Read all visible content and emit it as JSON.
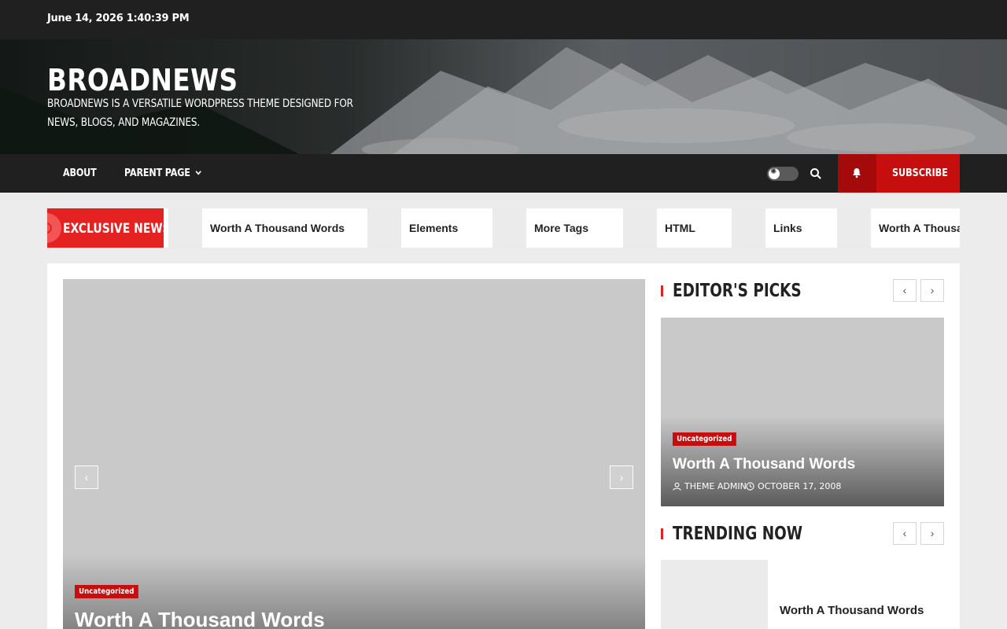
{
  "topbar": {
    "datetime": "June 14, 2026 1:40:39 PM"
  },
  "header": {
    "site_title": "BROADNEWS",
    "site_description": "BROADNEWS IS A VERSATILE WORDPRESS THEME DESIGNED FOR NEWS, BLOGS, AND MAGAZINES."
  },
  "nav": {
    "items": [
      {
        "label": "ABOUT"
      },
      {
        "label": "PARENT PAGE"
      }
    ],
    "subscribe_label": "SUBSCRIBE",
    "icons": [
      "sun-icon",
      "search-icon",
      "bell-icon",
      "chevron-down-icon"
    ]
  },
  "ticker": {
    "label": "EXCLUSIVE NEWS",
    "items": [
      {
        "title": "Worth A Thousand Words"
      },
      {
        "title": "Elements"
      },
      {
        "title": "More Tags"
      },
      {
        "title": "HTML"
      },
      {
        "title": "Links"
      },
      {
        "title": "Worth A Thousand Words"
      }
    ]
  },
  "main_slider": {
    "category": "Uncategorized",
    "title": "Worth A Thousand Words",
    "prev": "‹",
    "next": "›"
  },
  "editors_picks": {
    "heading": "EDITOR'S PICKS",
    "category": "Uncategorized",
    "title": "Worth A Thousand Words",
    "author": "THEME ADMIN",
    "date": "OCTOBER 17, 2008",
    "prev": "‹",
    "next": "›"
  },
  "trending": {
    "heading": "TRENDING NOW",
    "items": [
      {
        "title": "Worth A Thousand Words"
      }
    ],
    "prev": "‹",
    "next": "›"
  },
  "colors": {
    "accent": "#e52222",
    "dark": "#202020",
    "subscribe": "#c60e0e"
  }
}
